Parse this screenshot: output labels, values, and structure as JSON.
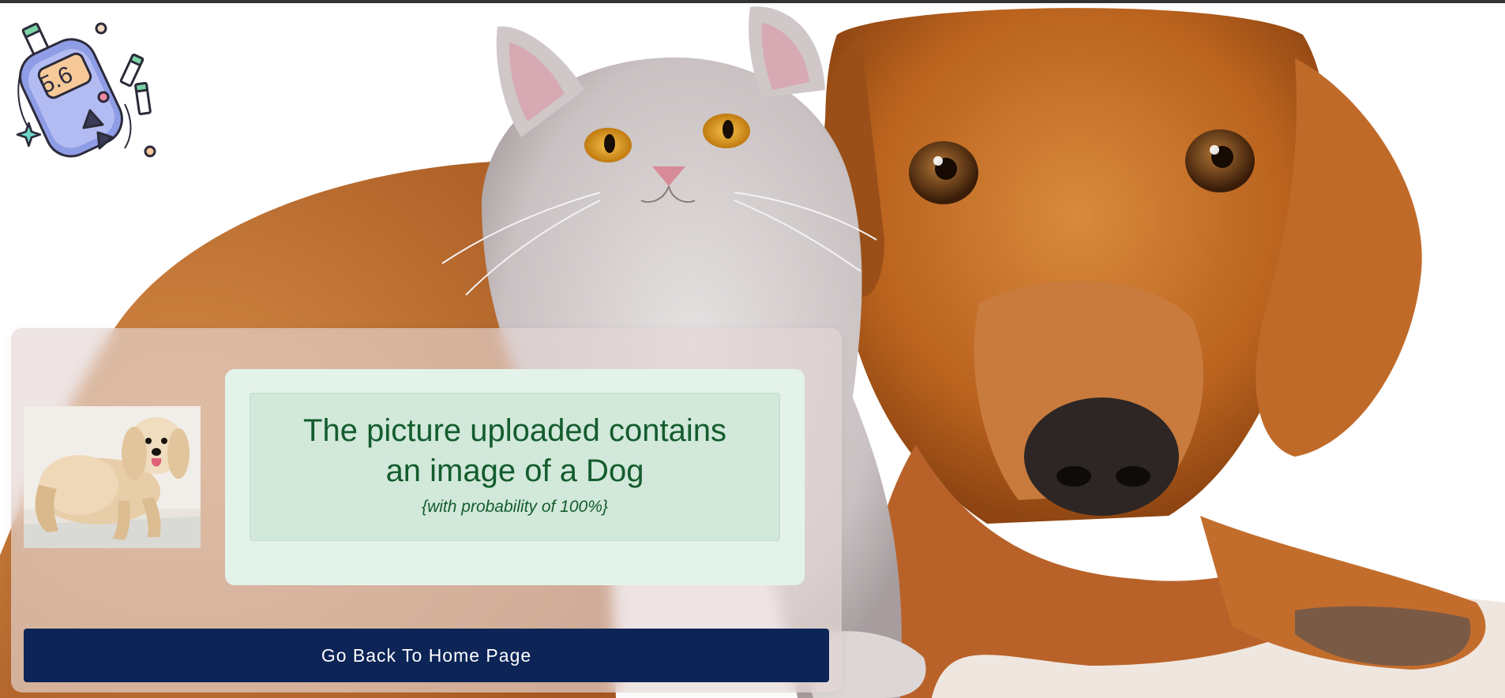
{
  "logo": {
    "icon": "glucose-meter-icon",
    "display_value": "5.6"
  },
  "background": {
    "subject": "cat-and-dog-photo"
  },
  "result": {
    "heading": "The picture uploaded contains an image of a Dog",
    "probability_text": "{with probability of 100%}",
    "uploaded_image": "uploaded-dog-thumbnail"
  },
  "actions": {
    "home_button_label": "Go Back To Home Page"
  },
  "colors": {
    "button_bg": "#0c2456",
    "success_text": "#145c2d",
    "success_panel": "#d1e8da",
    "message_box": "#e4f3ea"
  }
}
